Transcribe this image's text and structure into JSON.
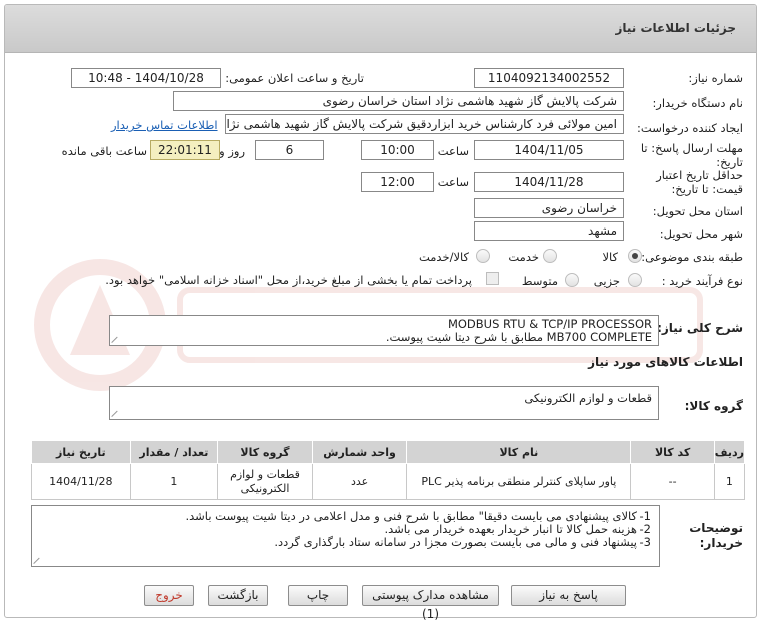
{
  "panel": {
    "title": "جزئیات اطلاعات نیاز"
  },
  "fields": {
    "need_number": {
      "label": "شماره نیاز:",
      "value": "1104092134002552"
    },
    "announce_datetime": {
      "label": "تاریخ و ساعت اعلان عمومی:",
      "value": "1404/10/28 - 10:48"
    },
    "buyer_org": {
      "label": "نام دستگاه خریدار:",
      "value": "شرکت پالایش گاز شهید هاشمی نژاد   استان خراسان رضوی"
    },
    "requester": {
      "label": "ایجاد کننده درخواست:",
      "value": "امین مولائی فرد کارشناس خرید ابزاردقیق شرکت پالایش گاز شهید هاشمی نژاد",
      "contact_link": "اطلاعات تماس خریدار"
    },
    "response_deadline": {
      "label_line1": "مهلت ارسال پاسخ: تا",
      "label_line2": "تاریخ:",
      "date": "1404/11/05",
      "time_label": "ساعت",
      "time": "10:00",
      "days": "6",
      "days_label": "روز و",
      "remaining": "22:01:11",
      "remaining_label": "ساعت باقی مانده"
    },
    "price_validity": {
      "label_line1": "حداقل تاریخ اعتبار",
      "label_line2": "قیمت: تا تاریخ:",
      "date": "1404/11/28",
      "time_label": "ساعت",
      "time": "12:00"
    },
    "delivery_province": {
      "label": "استان محل تحویل:",
      "value": "خراسان رضوی"
    },
    "delivery_city": {
      "label": "شهر محل تحویل:",
      "value": "مشهد"
    },
    "subject_class": {
      "label": "طبقه بندی موضوعی:",
      "options": [
        "کالا",
        "خدمت",
        "کالا/خدمت"
      ],
      "selected": "کالا"
    },
    "purchase_process": {
      "label": "نوع فرآیند خرید :",
      "options": [
        "جزیی",
        "متوسط"
      ],
      "selected": "",
      "payment_note": "پرداخت تمام یا بخشی از مبلغ خرید،از محل \"اسناد خزانه اسلامی\" خواهد بود."
    }
  },
  "summary": {
    "label": "شرح کلی نیاز:",
    "line1": "MODBUS RTU & TCP/IP PROCESSOR",
    "line2": "MB700 COMPLETE  مطابق با شرح دیتا شیت پیوست."
  },
  "goods_info_heading": "اطلاعات کالاهای مورد نیاز",
  "goods_group": {
    "label": "گروه کالا:",
    "value": "قطعات و لوازم الکترونیکی"
  },
  "table": {
    "headers": [
      "ردیف",
      "کد کالا",
      "نام کالا",
      "واحد شمارش",
      "گروه کالا",
      "تعداد / مقدار",
      "تاریخ نیاز"
    ],
    "rows": [
      {
        "row": "1",
        "code": "--",
        "name": "پاور ساپلای کنترلر منطقی برنامه پذیر PLC",
        "unit": "عدد",
        "group": "قطعات و لوازم الکترونیکی",
        "qty": "1",
        "date": "1404/11/28"
      }
    ]
  },
  "buyer_notes": {
    "label_line1": "توضیحات",
    "label_line2": "خریدار:",
    "items": [
      {
        "num": "1-",
        "text": "کالای پیشنهادی می بایست دقیقا\" مطابق با شرح فنی و مدل اعلامی در دیتا شیت پیوست باشد."
      },
      {
        "num": "2-",
        "text": "هزینه حمل کالا تا انبار خریدار بعهده خریدار می باشد."
      },
      {
        "num": "3-",
        "text": "پیشنهاد فنی و مالی می بایست بصورت مجزا در سامانه ستاد بارگذاری گردد."
      }
    ]
  },
  "buttons": {
    "respond": "پاسخ به نیاز",
    "view_docs": "مشاهده مدارک پیوستی (1)",
    "print": "چاپ",
    "back": "بازگشت",
    "exit": "خروج"
  },
  "colors": {
    "title_bar": "#d2d2d2",
    "link": "#1a5fb4",
    "remaining_bg": "#f4efc0",
    "exit_text": "#c0392b"
  }
}
